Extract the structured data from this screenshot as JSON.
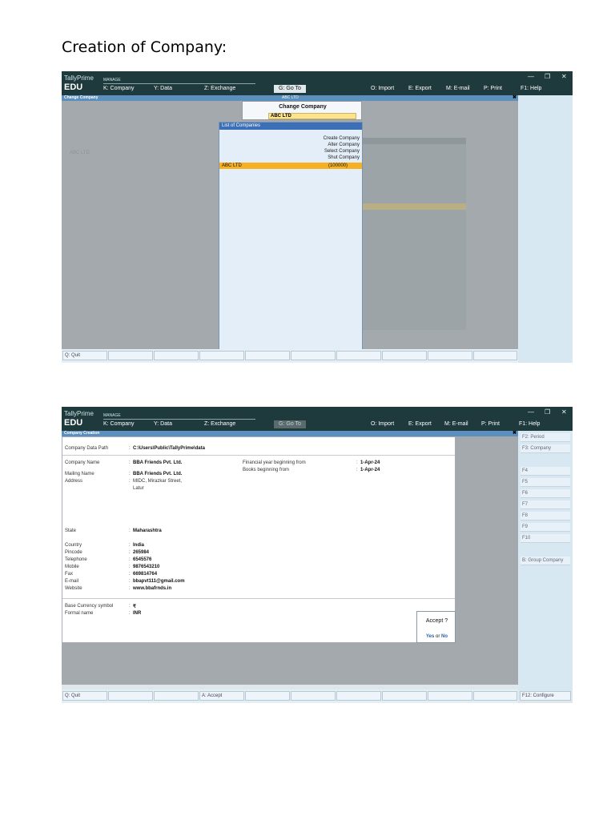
{
  "doc_title": "Creation of Company:",
  "app": {
    "brand": "TallyPrime",
    "edition": "EDU",
    "manage_label": "MANAGE",
    "menu": {
      "company": "K: Company",
      "data": "Y: Data",
      "exchange": "Z: Exchange",
      "goto": "G: Go To",
      "import": "O: Import",
      "export": "E: Export",
      "email": "M: E-mail",
      "print": "P: Print",
      "help": "F1: Help"
    },
    "window_controls": {
      "minimize": "—",
      "restore": "❐",
      "close": "✕"
    }
  },
  "screen1": {
    "subbar_left": "Change Company",
    "subbar_center": "ABC LTD",
    "close_x": "✖",
    "change_company_title": "Change Company",
    "change_company_value": "ABC LTD",
    "list_title": "List of Companies",
    "list_actions": [
      "Create Company",
      "Alter Company",
      "Select Company",
      "Shut Company"
    ],
    "selected_company": {
      "name": "ABC LTD",
      "number": "(100000)"
    },
    "background_company": "ABC LTD",
    "quit": "Q: Quit"
  },
  "screen2": {
    "subbar_left": "Company Creation",
    "close_x": "✖",
    "fields": {
      "data_path_label": "Company Data Path",
      "data_path_value": "C:\\Users\\Public\\TallyPrime\\data",
      "name_label": "Company Name",
      "name_value": "BBA Friends Pvt. Ltd.",
      "mailing_label": "Mailing Name",
      "mailing_value": "BBA Friends Pvt. Ltd.",
      "address_label": "Address",
      "address_line1": "MIDC, Mirazkar Street,",
      "address_line2": "Latur",
      "fy_label": "Financial year beginning from",
      "fy_value": "1-Apr-24",
      "books_label": "Books beginning from",
      "books_value": "1-Apr-24",
      "state_label": "State",
      "state_value": "Maharashtra",
      "country_label": "Country",
      "country_value": "India",
      "pincode_label": "Pincode",
      "pincode_value": "265984",
      "telephone_label": "Telephone",
      "telephone_value": "6545576",
      "mobile_label": "Mobile",
      "mobile_value": "9876543210",
      "fax_label": "Fax",
      "fax_value": "669814764",
      "email_label": "E-mail",
      "email_value": "bbapvt111@gmail.com",
      "website_label": "Website",
      "website_value": "www.bbafrnds.in",
      "currency_label": "Base Currency symbol",
      "currency_value": "₹",
      "formal_label": "Formal name",
      "formal_value": "INR"
    },
    "accept": {
      "question": "Accept ?",
      "yes": "Yes",
      "or": "or",
      "no": "No"
    },
    "right_panel": [
      "F2: Period",
      "F3: Company",
      "F4",
      "F5",
      "F6",
      "F7",
      "F8",
      "F9",
      "F10",
      "B: Group Company"
    ],
    "bottom": {
      "quit": "Q: Quit",
      "accept": "A: Accept",
      "configure": "F12: Configure"
    }
  }
}
